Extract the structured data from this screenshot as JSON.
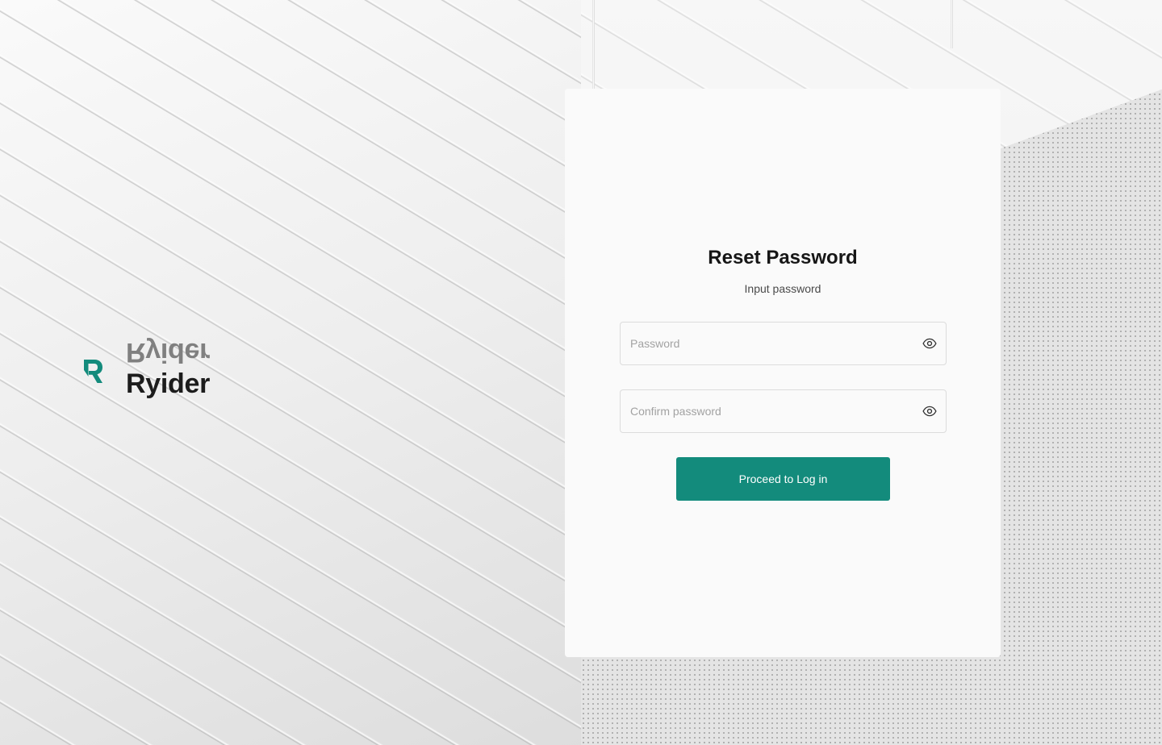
{
  "brand": {
    "name": "Ryider",
    "accent_color": "#138b7c",
    "logo_icon": "ryider-logo-icon"
  },
  "reset_form": {
    "title": "Reset Password",
    "subtitle": "Input password",
    "password_field": {
      "placeholder": "Password",
      "value": "",
      "icon": "eye-icon"
    },
    "confirm_field": {
      "placeholder": "Confirm password",
      "value": "",
      "icon": "eye-icon"
    },
    "submit_label": "Proceed to Log in"
  }
}
